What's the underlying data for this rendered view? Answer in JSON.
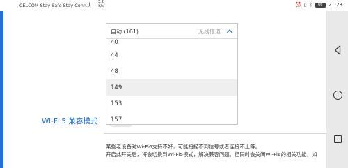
{
  "status_bar": {
    "carrier": "CELCOM Stay Safe Stay Conn...",
    "signal": "..ll",
    "speed_value": "3.2",
    "speed_unit": "K/s",
    "battery": "66",
    "time": "21:23"
  },
  "dropdown": {
    "selected": "自动 (161)",
    "placeholder": "无线信道",
    "options": [
      "40",
      "44",
      "48",
      "149",
      "153",
      "157"
    ],
    "highlighted_option": "149"
  },
  "compat_mode": {
    "label": "Wi-Fi 5 兼容模式",
    "enabled": false
  },
  "description": {
    "line1": "某些老设备对Wi-Fi6支持不好，可能扫描不到信号或者连接不上等。",
    "line2": "开启此开关后，将会切换到Wi-Fi5模式，解决兼容问题。但同时会关闭Wi-Fi6的相关功能，如"
  },
  "colors": {
    "accent": "#1f6fdc",
    "selected_row": "#efefef"
  }
}
